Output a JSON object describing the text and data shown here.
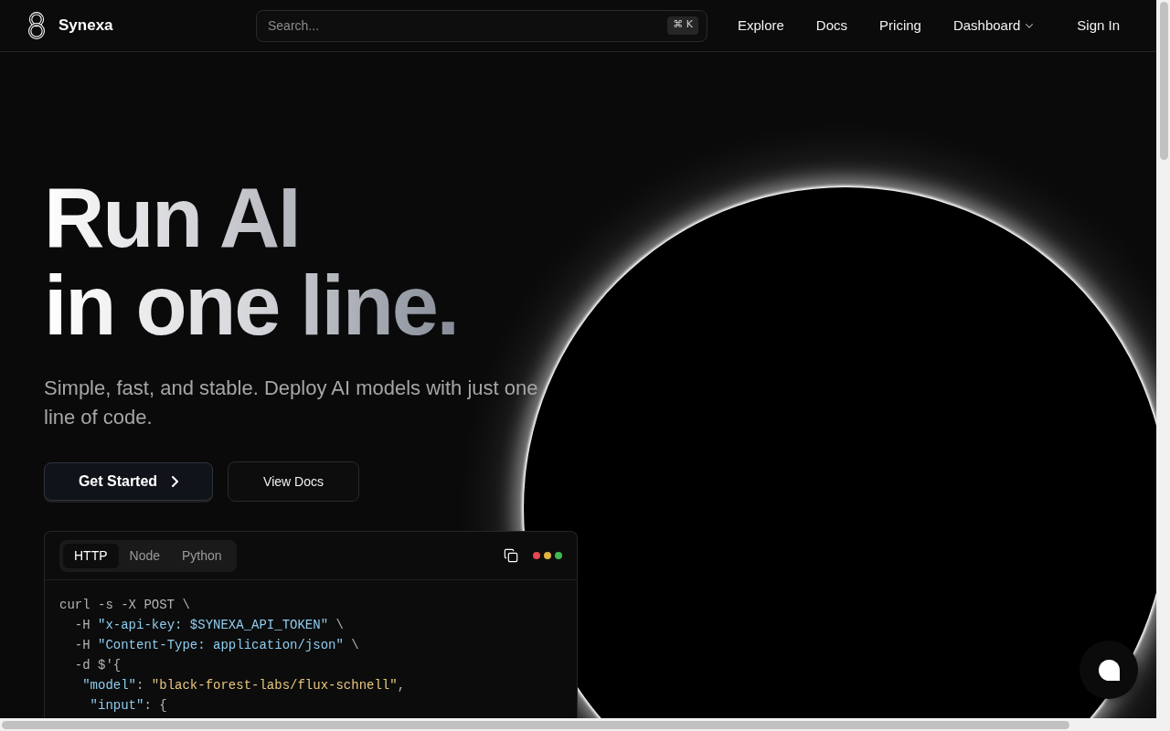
{
  "header": {
    "brand": "Synexa",
    "search": {
      "placeholder": "Search...",
      "shortcut": "⌘ K"
    },
    "nav": [
      {
        "label": "Explore",
        "kind": "link"
      },
      {
        "label": "Docs",
        "kind": "link"
      },
      {
        "label": "Pricing",
        "kind": "link"
      },
      {
        "label": "Dashboard",
        "kind": "dropdown"
      }
    ],
    "sign_in": "Sign In"
  },
  "hero": {
    "title": [
      "Run AI",
      "in one line."
    ],
    "subtitle": "Simple, fast, and stable. Deploy AI models with just one line of code.",
    "buttons": [
      {
        "label": "Get Started",
        "kind": "primary"
      },
      {
        "label": "View Docs",
        "kind": "secondary"
      }
    ]
  },
  "code_panel": {
    "tabs": [
      {
        "label": "HTTP",
        "selected": true
      },
      {
        "label": "Node",
        "selected": false
      },
      {
        "label": "Python",
        "selected": false
      }
    ],
    "window_dots": [
      {
        "color": "#e5484d"
      },
      {
        "color": "#e3b341"
      },
      {
        "color": "#3fb950"
      }
    ],
    "lines": [
      [
        {
          "kind": "plain",
          "text": "curl -s -X POST \\"
        }
      ],
      [
        {
          "kind": "plain",
          "text": "  -H "
        },
        {
          "kind": "string",
          "text": "\"x-api-key: $SYNEXA_API_TOKEN\""
        },
        {
          "kind": "plain",
          "text": " \\"
        }
      ],
      [
        {
          "kind": "plain",
          "text": "  -H "
        },
        {
          "kind": "string",
          "text": "\"Content-Type: application/json\""
        },
        {
          "kind": "plain",
          "text": " \\"
        }
      ],
      [
        {
          "kind": "plain",
          "text": "  -d $'{"
        }
      ],
      [
        {
          "kind": "string",
          "text": "   \"model\""
        },
        {
          "kind": "plain",
          "text": ": "
        },
        {
          "kind": "value",
          "text": "\"black-forest-labs/flux-schnell\""
        },
        {
          "kind": "plain",
          "text": ","
        }
      ],
      [
        {
          "kind": "string",
          "text": "    \"input\""
        },
        {
          "kind": "plain",
          "text": ": {"
        }
      ]
    ]
  }
}
